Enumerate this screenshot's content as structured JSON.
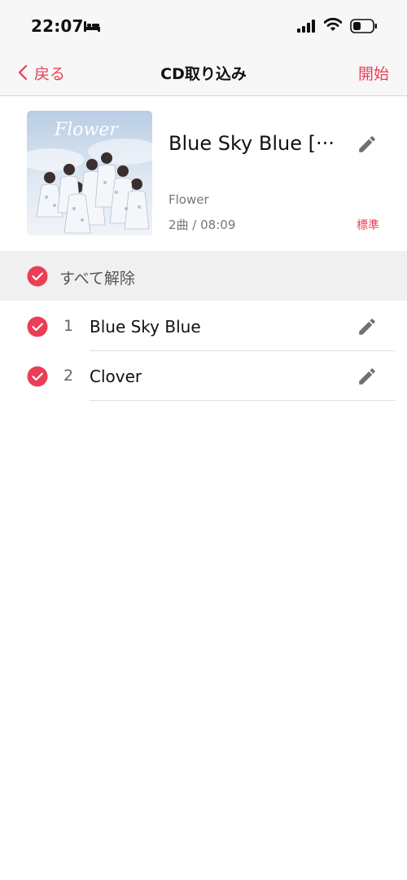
{
  "status_bar": {
    "time": "22:07",
    "icons": [
      "bed-icon",
      "signal-icon",
      "wifi-icon",
      "battery-icon"
    ]
  },
  "nav": {
    "back_label": "戻る",
    "title": "CD取り込み",
    "start_label": "開始"
  },
  "album": {
    "art_text": "Flower",
    "title": "Blue Sky Blue [···",
    "artist": "Flower",
    "meta": "2曲 / 08:09",
    "quality": "標準"
  },
  "select_all": {
    "label": "すべて解除",
    "checked": true
  },
  "tracks": [
    {
      "number": "1",
      "title": "Blue Sky Blue",
      "checked": true
    },
    {
      "number": "2",
      "title": "Clover",
      "checked": true
    }
  ],
  "colors": {
    "accent": "#ea3e55",
    "nav_background": "#f7f7f7",
    "select_bar_background": "#f0f0f0",
    "secondary_text": "#777777"
  }
}
